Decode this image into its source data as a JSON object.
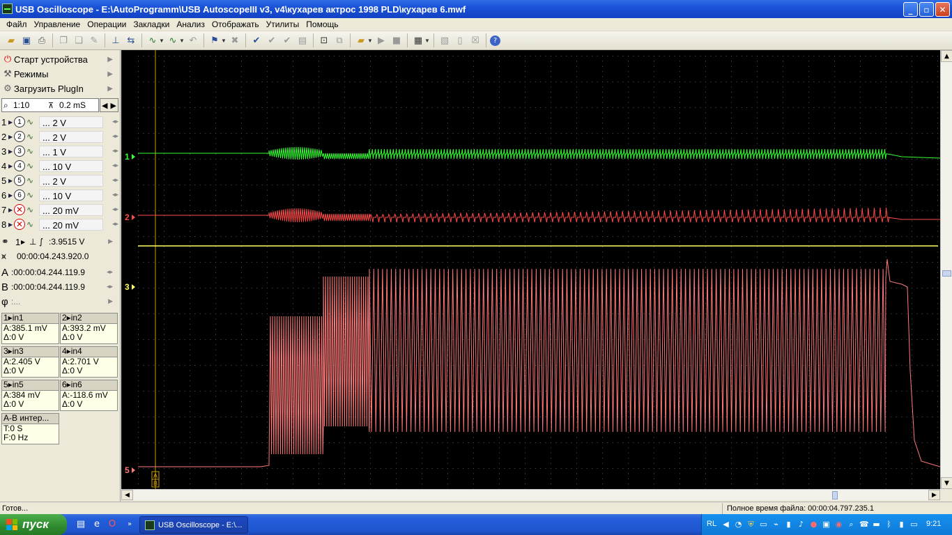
{
  "window": {
    "title": "USB Oscilloscope - E:\\AutoProgramm\\USB AutoscopeIII v3, v4\\кухарев актрос 1998 PLD\\кухарев 6.mwf",
    "min": "_",
    "max": "▫",
    "close": "✕"
  },
  "menu": [
    "Файл",
    "Управление",
    "Операции",
    "Закладки",
    "Анализ",
    "Отображать",
    "Утилиты",
    "Помощь"
  ],
  "left": {
    "items": [
      {
        "label": "Старт устройства",
        "icon": "power-icon"
      },
      {
        "label": "Режимы",
        "icon": "modes-icon"
      },
      {
        "label": "Загрузить PlugIn",
        "icon": "plugin-icon"
      }
    ],
    "zoom": "1:10",
    "timebase": "0.2 mS",
    "channels": [
      {
        "num": "1",
        "circ": "1",
        "val": "... 2 V",
        "off": false
      },
      {
        "num": "2",
        "circ": "2",
        "val": "... 2 V",
        "off": false
      },
      {
        "num": "3",
        "circ": "3",
        "val": "... 1 V",
        "off": false
      },
      {
        "num": "4",
        "circ": "4",
        "val": "... 10 V",
        "off": false
      },
      {
        "num": "5",
        "circ": "5",
        "val": "... 2 V",
        "off": false
      },
      {
        "num": "6",
        "circ": "6",
        "val": "... 10 V",
        "off": false
      },
      {
        "num": "7",
        "circ": "✕",
        "val": "... 20 mV",
        "off": true
      },
      {
        "num": "8",
        "circ": "✕",
        "val": "... 20 mV",
        "off": true
      }
    ],
    "trigger_ch": "1",
    "trigger_level": ":3.9515 V",
    "trigger_time": "00:00:04.243.920.0",
    "cursor_a_label": "A",
    "cursor_a": ":00:00:04.244.119.9",
    "cursor_b_label": "B",
    "cursor_b": ":00:00:04.244.119.9",
    "phi_label": "φ",
    "phi": ":...",
    "measures": [
      {
        "hd": "1▸in1",
        "a": "A:385.1 mV",
        "d": "Δ:0 V"
      },
      {
        "hd": "2▸in2",
        "a": "A:393.2 mV",
        "d": "Δ:0 V"
      },
      {
        "hd": "3▸in3",
        "a": "A:2.405 V",
        "d": "Δ:0 V"
      },
      {
        "hd": "4▸in4",
        "a": "A:2.701 V",
        "d": "Δ:0 V"
      },
      {
        "hd": "5▸in5",
        "a": "A:384 mV",
        "d": "Δ:0 V"
      },
      {
        "hd": "6▸in6",
        "a": "A:-118.6 mV",
        "d": "Δ:0 V"
      }
    ],
    "interval": {
      "hd": "A-B интер...",
      "t": "T:0 S",
      "f": "F:0 Hz"
    }
  },
  "scope": {
    "markers": [
      "1",
      "2",
      "3",
      "5"
    ],
    "cursor_labels": [
      "A",
      "B"
    ],
    "colors": {
      "ch1": "#33ff33",
      "ch2": "#ff4a4a",
      "ch5": "#ff7a7a",
      "ch3_line": "#ffff66",
      "grid": "#5a5a5a",
      "cursor": "#c8a000"
    }
  },
  "status": {
    "left": "Готов...",
    "right": "Полное время файла: 00:00:04.797.235.1"
  },
  "taskbar": {
    "start": "пуск",
    "task": "USB Oscilloscope - E:\\...",
    "lang": "RL",
    "clock": "9:21"
  }
}
